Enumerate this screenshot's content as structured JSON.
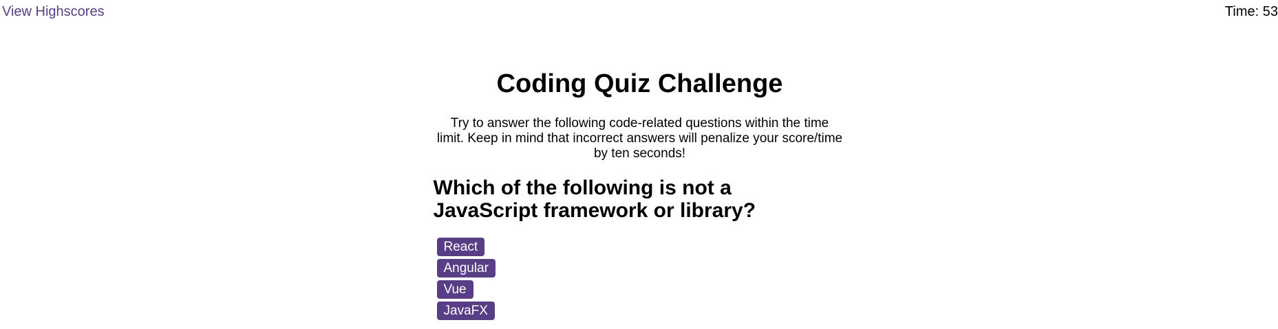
{
  "header": {
    "highscores_link": "View Highscores",
    "timer_label": "Time:",
    "timer_value": "53"
  },
  "quiz": {
    "title": "Coding Quiz Challenge",
    "intro": "Try to answer the following code-related questions within the time limit. Keep in mind that incorrect answers will penalize your score/time by ten seconds!",
    "question": "Which of the following is not a JavaScript framework or library?",
    "choices": [
      "React",
      "Angular",
      "Vue",
      "JavaFX"
    ]
  },
  "colors": {
    "accent": "#5a3e85",
    "button_text": "#ffffff"
  }
}
